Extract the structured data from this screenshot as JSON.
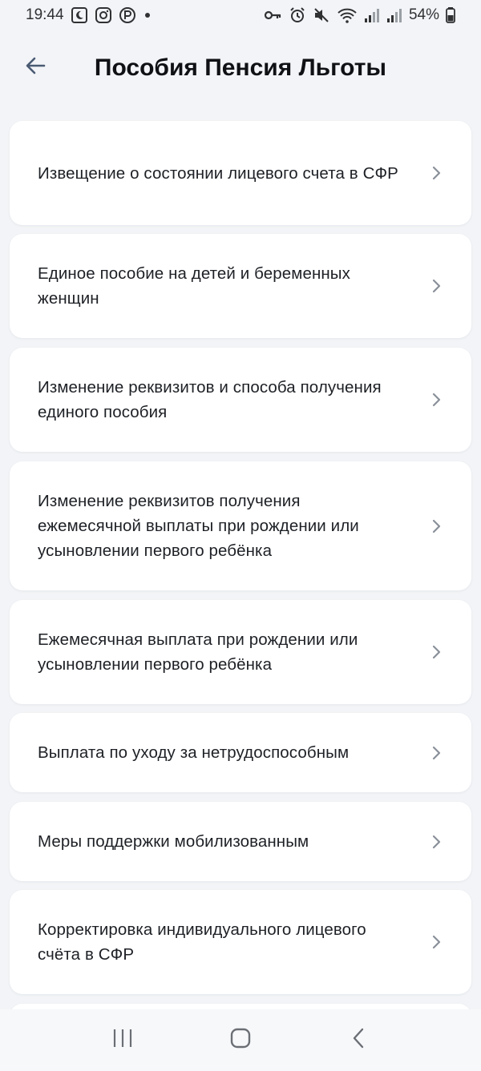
{
  "status_bar": {
    "time": "19:44",
    "battery": "54%",
    "left_icons": [
      "night-mode-icon",
      "instagram-icon",
      "p-app-icon",
      "dot-icon"
    ],
    "right_icons": [
      "key-icon",
      "alarm-icon",
      "mute-icon",
      "wifi-icon",
      "signal-icon",
      "signal-icon",
      "battery-icon"
    ]
  },
  "header": {
    "title": "Пособия Пенсия Льготы",
    "back_icon": "arrow-left-icon"
  },
  "menu": {
    "items": [
      {
        "label": "Извещение о состоянии лицевого счета в СФР"
      },
      {
        "label": "Единое пособие на детей и беременных женщин"
      },
      {
        "label": "Изменение реквизитов и способа получения единого пособия"
      },
      {
        "label": "Изменение реквизитов получения ежемесячной выплаты при рождении или усыновлении первого ребёнка"
      },
      {
        "label": "Ежемесячная выплата при рождении или усыновлении первого ребёнка"
      },
      {
        "label": "Выплата по уходу за нетрудоспособным"
      },
      {
        "label": "Меры поддержки мобилизованным"
      },
      {
        "label": "Корректировка индивидуального лицевого счёта в СФР"
      }
    ]
  },
  "colors": {
    "background": "#f2f4f7",
    "card": "#ffffff",
    "text": "#1d2025",
    "chevron": "#8a9099"
  },
  "nav_bar": {
    "buttons": [
      "recent-apps-icon",
      "home-icon",
      "back-icon"
    ]
  }
}
